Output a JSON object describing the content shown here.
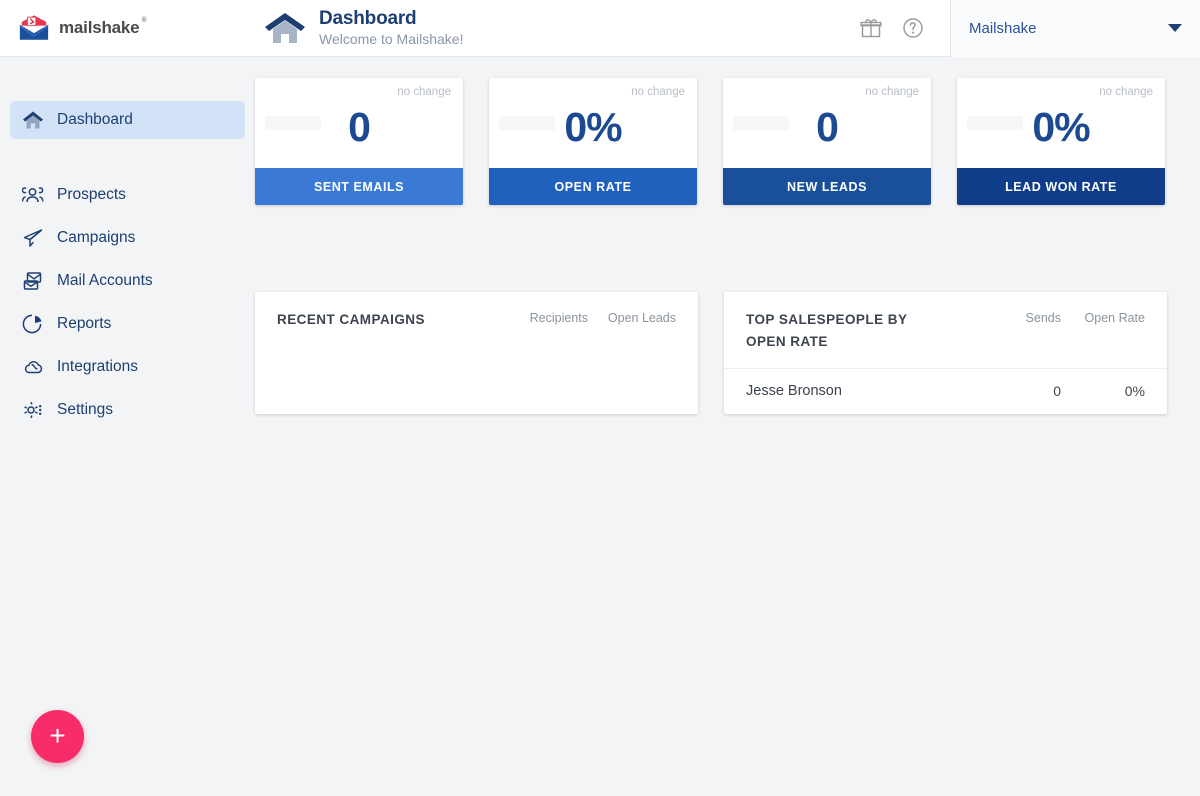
{
  "brand": {
    "name": "mailshake",
    "logo_icon": "mailshake-envelope-logo"
  },
  "header": {
    "home_icon": "house-icon",
    "title": "Dashboard",
    "subtitle": "Welcome to Mailshake!",
    "gift_icon": "gift-icon",
    "help_icon": "help-circle-icon",
    "account_name": "Mailshake",
    "caret_icon": "chevron-down-icon"
  },
  "sidebar": {
    "items": [
      {
        "label": "Dashboard",
        "icon": "house-icon",
        "active": true
      },
      {
        "label": "Prospects",
        "icon": "people-icon",
        "active": false
      },
      {
        "label": "Campaigns",
        "icon": "paper-plane-icon",
        "active": false
      },
      {
        "label": "Mail Accounts",
        "icon": "mail-stack-icon",
        "active": false
      },
      {
        "label": "Reports",
        "icon": "pie-chart-icon",
        "active": false
      },
      {
        "label": "Integrations",
        "icon": "plug-cloud-icon",
        "active": false
      },
      {
        "label": "Settings",
        "icon": "gear-icon",
        "active": false
      }
    ]
  },
  "stats": [
    {
      "value": "0",
      "change": "no change",
      "label": "SENT EMAILS",
      "footer_color": "#3a7ad4"
    },
    {
      "value": "0%",
      "change": "no change",
      "label": "OPEN RATE",
      "footer_color": "#2061bd"
    },
    {
      "value": "0",
      "change": "no change",
      "label": "NEW LEADS",
      "footer_color": "#1a4f9c"
    },
    {
      "value": "0%",
      "change": "no change",
      "label": "LEAD WON RATE",
      "footer_color": "#103d8a"
    }
  ],
  "recent_campaigns": {
    "title": "RECENT CAMPAIGNS",
    "columns": [
      "Recipients",
      "Open Leads"
    ],
    "rows": []
  },
  "top_salespeople": {
    "title": "TOP SALESPEOPLE BY OPEN RATE",
    "columns": [
      "Sends",
      "Open Rate"
    ],
    "rows": [
      {
        "name": "Jesse Bronson",
        "sends": "0",
        "open_rate": "0%"
      }
    ]
  },
  "fab": {
    "icon": "plus-icon",
    "label": "+",
    "color": "#f72c68"
  }
}
